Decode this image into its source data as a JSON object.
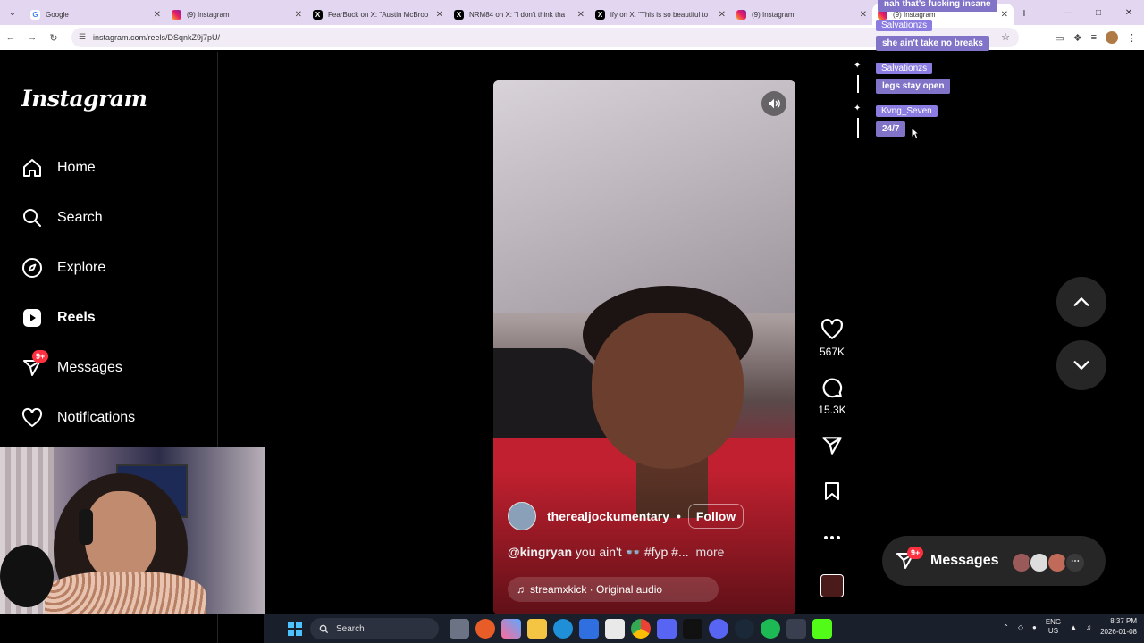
{
  "browser": {
    "tabs": [
      {
        "title": "Google",
        "favicon": "google-icon"
      },
      {
        "title": "(9) Instagram",
        "favicon": "instagram-icon"
      },
      {
        "title": "FearBuck on X: \"Austin McBroo",
        "favicon": "x-icon"
      },
      {
        "title": "NRM84 on X: \"I don't think tha",
        "favicon": "x-icon"
      },
      {
        "title": "ify on X: \"This is so beautiful to",
        "favicon": "x-icon"
      },
      {
        "title": "(9) Instagram",
        "favicon": "instagram-icon"
      },
      {
        "title": "(9) Instagram",
        "favicon": "instagram-icon",
        "active": true
      }
    ],
    "url": "instagram.com/reels/DSqnkZ9j7pU/"
  },
  "sidebar": {
    "logo": "Instagram",
    "items": [
      {
        "label": "Home",
        "icon": "home-icon"
      },
      {
        "label": "Search",
        "icon": "search-icon"
      },
      {
        "label": "Explore",
        "icon": "compass-icon"
      },
      {
        "label": "Reels",
        "icon": "reels-icon",
        "active": true
      },
      {
        "label": "Messages",
        "icon": "messenger-icon",
        "badge": "9+"
      },
      {
        "label": "Notifications",
        "icon": "heart-icon"
      }
    ]
  },
  "reel": {
    "username": "therealjockumentary",
    "separator": "•",
    "follow_label": "Follow",
    "caption_mention": "@kingryan",
    "caption_text": "you ain't 👓 #fyp #...",
    "caption_more": "more",
    "audio_label": "streamxkick · Original audio"
  },
  "actions": {
    "likes": "567K",
    "comments": "15.3K"
  },
  "messages_pill": {
    "label": "Messages",
    "badge": "9+"
  },
  "chat_overlay": {
    "entries": [
      {
        "text": "nah that's fucking insane"
      },
      {
        "name": "Salvationzs",
        "text": "she ain't take no breaks"
      },
      {
        "name": "Salvationzs",
        "text": "legs stay open"
      },
      {
        "name": "Kvng_Seven",
        "text": "24/7"
      }
    ]
  },
  "taskbar": {
    "search_label": "Search",
    "lang_top": "ENG",
    "lang_bottom": "US",
    "time": "8:37 PM",
    "date": "2026-01-08"
  },
  "colors": {
    "ig_bg": "#000000",
    "badge_red": "#ff3040",
    "chat_purple": "#8173c8",
    "tab_strip": "#e3d6f0"
  }
}
